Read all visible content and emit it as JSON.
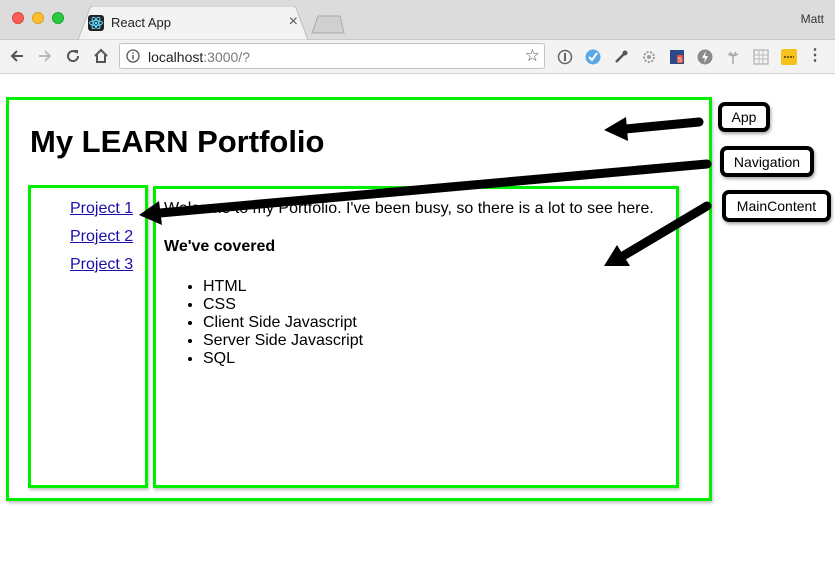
{
  "browser": {
    "tab_title": "React App",
    "tab_close": "×",
    "profile_name": "Matt",
    "url_host": "localhost",
    "url_rest": ":3000/?",
    "star_glyph": "☆",
    "menu_glyph": "⋮",
    "extensions": [
      "info-extension",
      "vpn-extension",
      "eyedropper-extension",
      "settings-extension",
      "calendar-extension",
      "lightning-extension",
      "palm-extension",
      "grid-extension",
      "notes-extension"
    ]
  },
  "page": {
    "title": "My LEARN Portfolio",
    "nav_links": [
      "Project 1",
      "Project 2",
      "Project 3"
    ],
    "welcome_text": "Welcome to my Portfolio. I've been busy, so there is a lot to see here.",
    "covered_heading": "We've covered",
    "topics": [
      "HTML",
      "CSS",
      "Client Side Javascript",
      "Server Side Javascript",
      "SQL"
    ]
  },
  "annotations": {
    "app_label": "App",
    "navigation_label": "Navigation",
    "main_content_label": "MainContent"
  },
  "colors": {
    "component_border": "#00ee00",
    "link": "#1a0dab",
    "arrow": "#000000"
  }
}
